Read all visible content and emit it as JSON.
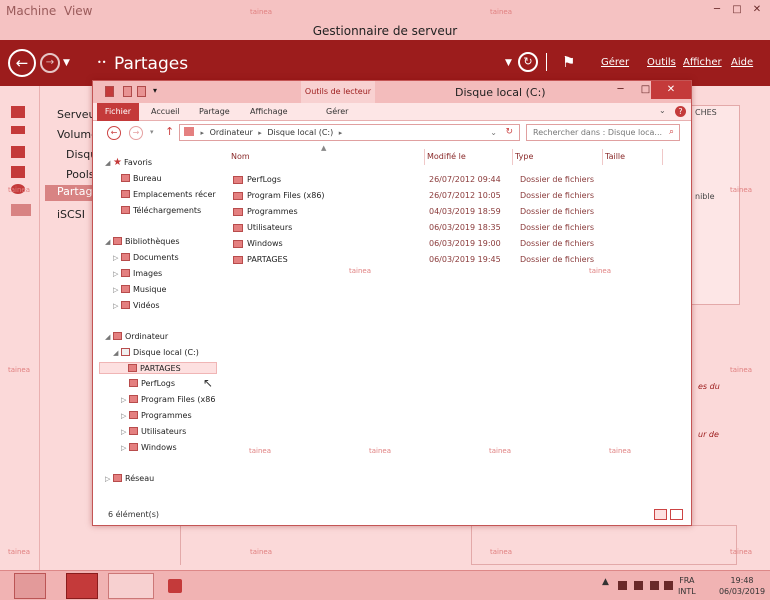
{
  "vm": {
    "menu": [
      "Machine",
      "View"
    ],
    "controls": [
      "─",
      "□",
      "✕"
    ]
  },
  "server_manager": {
    "title": "Gestionnaire de serveur",
    "breadcrumb_sep": "••",
    "breadcrumb": "Partages",
    "menu": [
      "Gérer",
      "Outils",
      "Afficher",
      "Aide"
    ],
    "nav": [
      "Serveur",
      "Volume",
      "Disqu",
      "Pools",
      "Partage",
      "iSCSI"
    ],
    "bg_fragments": [
      "CHES",
      "nible",
      "es du",
      "ur de"
    ],
    "watermark": "tainea"
  },
  "explorer": {
    "title": "Disque local (C:)",
    "context_tab": "Outils de lecteur",
    "ribbon_tabs": [
      "Fichier",
      "Accueil",
      "Partage",
      "Affichage",
      "Gérer"
    ],
    "address": [
      "Ordinateur",
      "Disque local (C:)"
    ],
    "search_placeholder": "Rechercher dans : Disque loca...",
    "tree": {
      "favorites": "Favoris",
      "fav_items": [
        "Bureau",
        "Emplacements récer",
        "Téléchargements"
      ],
      "libraries": "Bibliothèques",
      "lib_items": [
        "Documents",
        "Images",
        "Musique",
        "Vidéos"
      ],
      "computer": "Ordinateur",
      "drive": "Disque local (C:)",
      "folders": [
        "PARTAGES",
        "PerfLogs",
        "Program Files (x86",
        "Programmes",
        "Utilisateurs",
        "Windows"
      ],
      "network": "Réseau"
    },
    "columns": [
      "Nom",
      "Modifié le",
      "Type",
      "Taille"
    ],
    "files": [
      {
        "name": "PerfLogs",
        "date": "26/07/2012 09:44",
        "type": "Dossier de fichiers"
      },
      {
        "name": "Program Files (x86)",
        "date": "26/07/2012 10:05",
        "type": "Dossier de fichiers"
      },
      {
        "name": "Programmes",
        "date": "04/03/2019 18:59",
        "type": "Dossier de fichiers"
      },
      {
        "name": "Utilisateurs",
        "date": "06/03/2019 18:35",
        "type": "Dossier de fichiers"
      },
      {
        "name": "Windows",
        "date": "06/03/2019 19:00",
        "type": "Dossier de fichiers"
      },
      {
        "name": "PARTAGES",
        "date": "06/03/2019 19:45",
        "type": "Dossier de fichiers"
      }
    ],
    "status": "6 élément(s)"
  },
  "taskbar": {
    "lang1": "FRA",
    "lang2": "INTL",
    "time": "19:48",
    "date": "06/03/2019"
  },
  "colors": {
    "accent": "#9c1c1c",
    "selection": "#fde0e0"
  }
}
